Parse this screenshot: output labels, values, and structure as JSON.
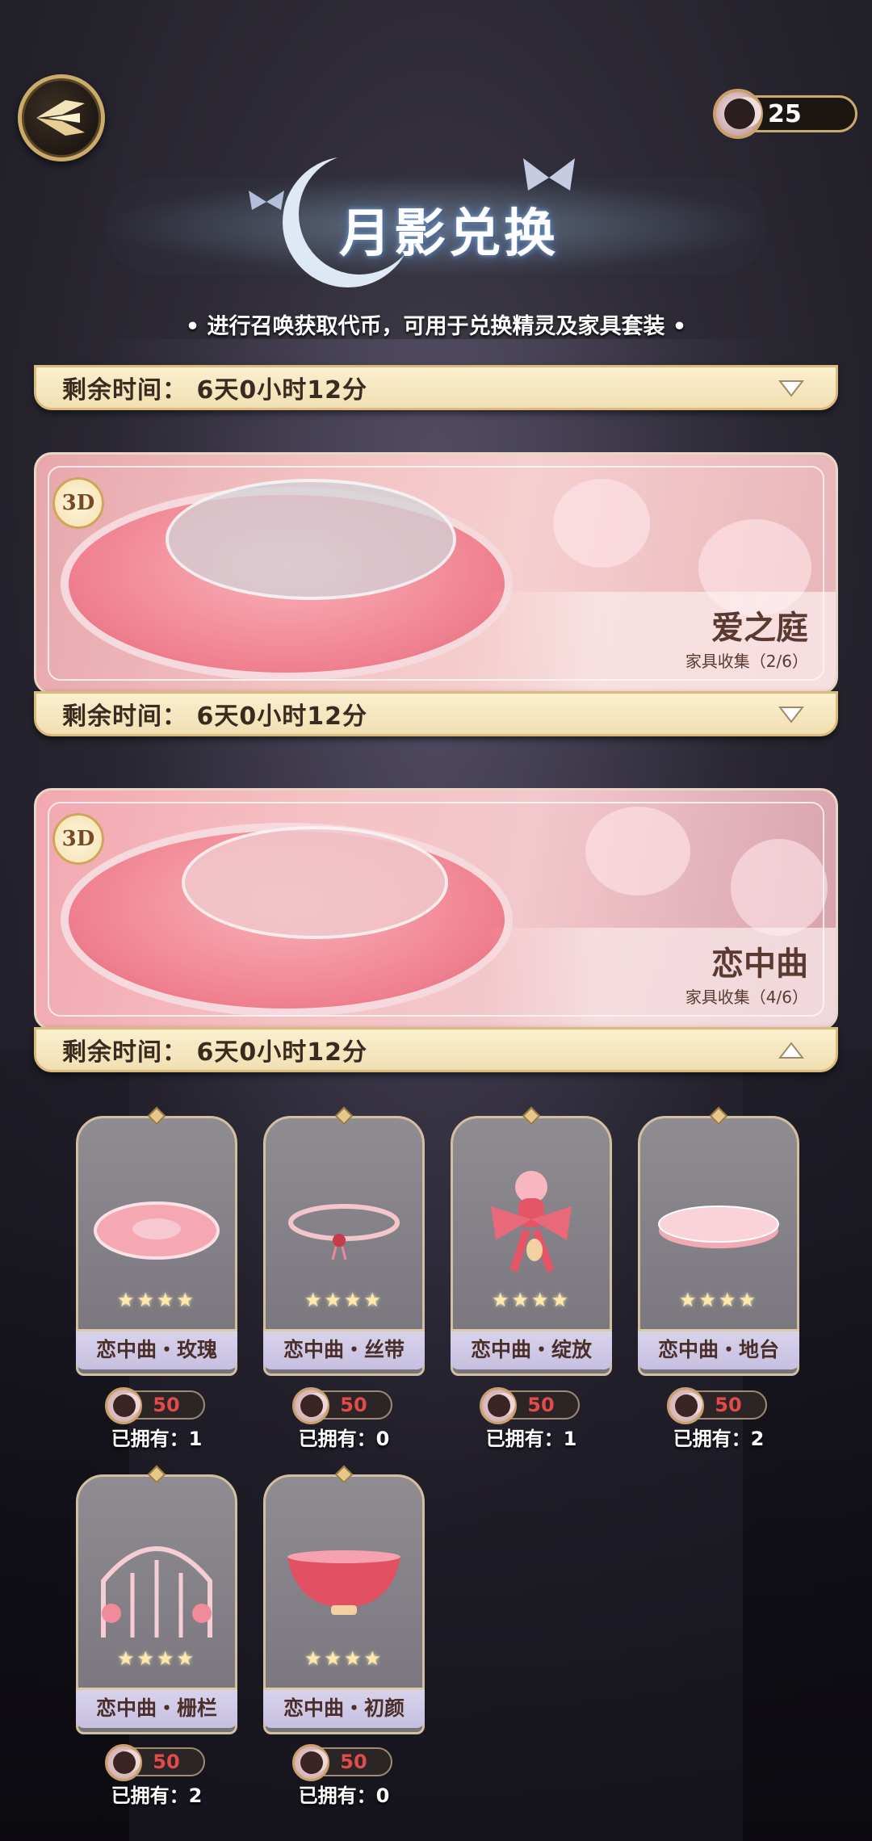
{
  "header": {
    "currency_count": "25",
    "title": "月影兑换",
    "subtitle": "• 进行召唤获取代币，可用于兑换精灵及家具套装 •"
  },
  "timer_top": {
    "label": "剩余时间：  6天0小时12分"
  },
  "sets": [
    {
      "badge": "3D",
      "name": "爱之庭",
      "collection": "家具收集（2/6）",
      "timer": "剩余时间：  6天0小时12分",
      "expanded": false
    },
    {
      "badge": "3D",
      "name": "恋中曲",
      "collection": "家具收集（4/6）",
      "timer": "剩余时间：  6天0小时12分",
      "expanded": true
    }
  ],
  "items": [
    {
      "name": "恋中曲・玫瑰",
      "stars": "★★★★",
      "price": "50",
      "owned": "已拥有：1",
      "art": "round-rug"
    },
    {
      "name": "恋中曲・丝带",
      "stars": "★★★★",
      "price": "50",
      "owned": "已拥有：0",
      "art": "ribbon-wreath"
    },
    {
      "name": "恋中曲・绽放",
      "stars": "★★★★",
      "price": "50",
      "owned": "已拥有：1",
      "art": "bow-vase"
    },
    {
      "name": "恋中曲・地台",
      "stars": "★★★★",
      "price": "50",
      "owned": "已拥有：2",
      "art": "platform"
    },
    {
      "name": "恋中曲・栅栏",
      "stars": "★★★★",
      "price": "50",
      "owned": "已拥有：2",
      "art": "arch-fence"
    },
    {
      "name": "恋中曲・初颜",
      "stars": "★★★★",
      "price": "50",
      "owned": "已拥有：0",
      "art": "bowl"
    }
  ],
  "icons": {
    "back": "wing-back-arrow-icon",
    "currency": "moon-token-icon",
    "collapse": "triangle-down-icon",
    "expand": "triangle-up-icon"
  },
  "colors": {
    "gold_border": "#c9ab6a",
    "price_red": "#e24b4b",
    "label_lavender": "#c6bfe0"
  }
}
